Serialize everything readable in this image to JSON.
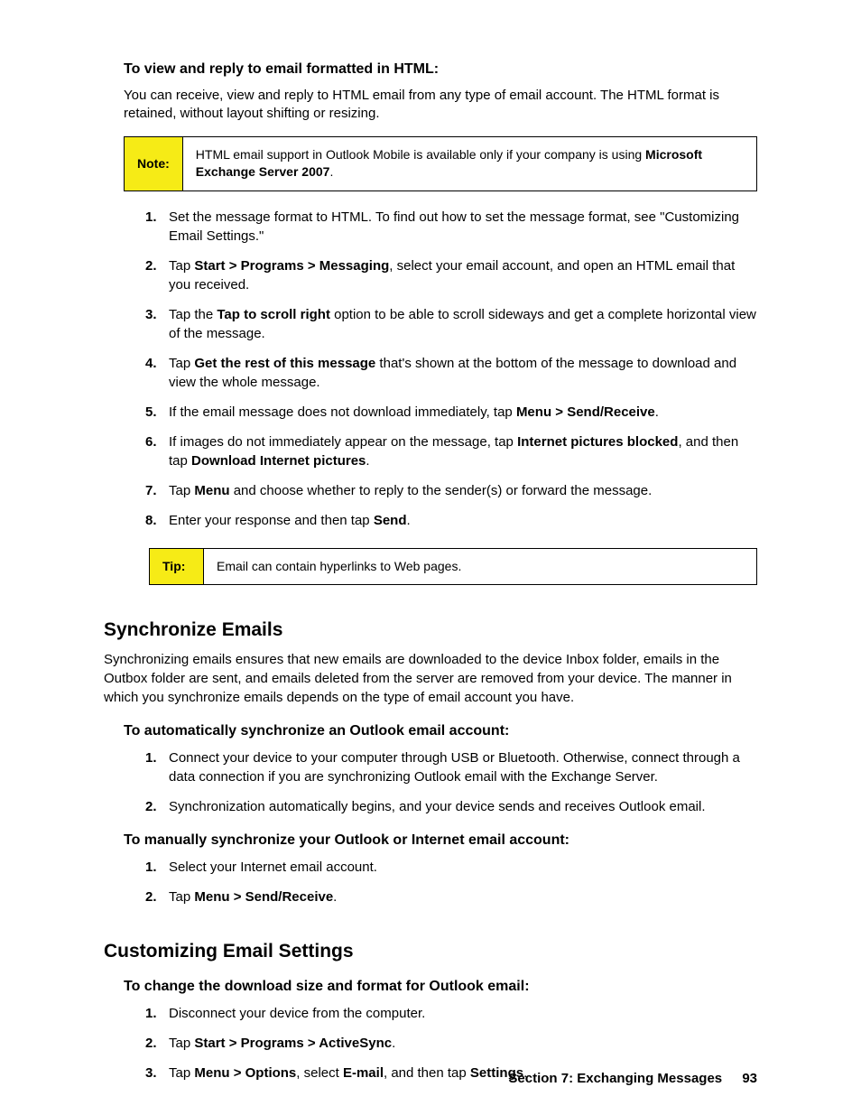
{
  "section1": {
    "heading": "To view and reply to email formatted in HTML:",
    "intro": "You can receive, view and reply to HTML email from any type of email account. The HTML format is retained, without layout shifting or resizing.",
    "note": {
      "label": "Note:",
      "text_before": "HTML email support in Outlook Mobile is available only if your company is using ",
      "bold": "Microsoft Exchange Server 2007",
      "text_after": "."
    },
    "steps": [
      {
        "text": "Set the message format to HTML. To find out how to set the message format, see \"Customizing Email Settings.\""
      },
      {
        "pre": "Tap ",
        "b1": "Start > Programs > Messaging",
        "post": ", select your email account, and open an HTML email that you received."
      },
      {
        "pre": "Tap the ",
        "b1": "Tap to scroll right",
        "post": " option to be able to scroll sideways and get a complete horizontal view of the message."
      },
      {
        "pre": "Tap ",
        "b1": "Get the rest of this message",
        "post": " that's shown at the bottom of the message to download and view the whole message."
      },
      {
        "pre": "If the email message does not download immediately, tap ",
        "b1": "Menu > Send/Receive",
        "post": "."
      },
      {
        "pre": "If images do not immediately appear on the message, tap ",
        "b1": "Internet pictures blocked",
        "mid": ", and then tap ",
        "b2": "Download Internet pictures",
        "post": "."
      },
      {
        "pre": "Tap ",
        "b1": "Menu",
        "post": " and choose whether to reply to the sender(s) or forward the message."
      },
      {
        "pre": "Enter your response and then tap ",
        "b1": "Send",
        "post": "."
      }
    ],
    "tip": {
      "label": "Tip:",
      "text": "Email can contain hyperlinks to Web pages."
    }
  },
  "section2": {
    "heading": "Synchronize Emails",
    "intro": "Synchronizing emails ensures that new emails are downloaded to the device Inbox folder, emails in the Outbox folder are sent, and emails deleted from the server are removed from your device. The manner in which you synchronize emails depends on the type of email account you have.",
    "sub1_heading": "To automatically synchronize an Outlook email account:",
    "sub1_steps": [
      {
        "text": "Connect your device to your computer through USB or Bluetooth. Otherwise, connect through a data connection if you are synchronizing Outlook email with the Exchange Server."
      },
      {
        "text": "Synchronization automatically begins, and your device sends and receives Outlook email."
      }
    ],
    "sub2_heading": "To manually synchronize your Outlook or Internet email account:",
    "sub2_steps": [
      {
        "text": "Select your Internet email account."
      },
      {
        "pre": "Tap ",
        "b1": "Menu > Send/Receive",
        "post": "."
      }
    ]
  },
  "section3": {
    "heading": "Customizing Email Settings",
    "sub1_heading": "To change the download size and format for Outlook email:",
    "steps": [
      {
        "text": "Disconnect your device from the computer."
      },
      {
        "pre": "Tap ",
        "b1": "Start > Programs > ActiveSync",
        "post": "."
      },
      {
        "pre": "Tap ",
        "b1": "Menu > Options",
        "mid": ", select ",
        "b2": "E-mail",
        "mid2": ", and then tap ",
        "b3": "Settings",
        "post": "."
      }
    ]
  },
  "footer": {
    "section": "Section 7: Exchanging Messages",
    "page": "93"
  }
}
